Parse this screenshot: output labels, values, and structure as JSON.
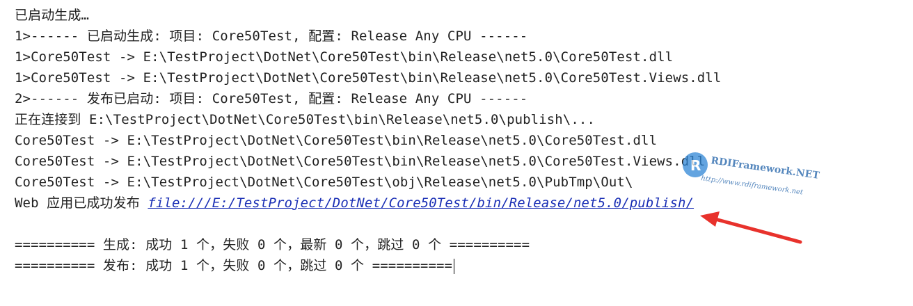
{
  "output": {
    "lines": [
      "已启动生成…",
      "1>------ 已启动生成: 项目: Core50Test, 配置: Release Any CPU ------",
      "1>Core50Test -> E:\\TestProject\\DotNet\\Core50Test\\bin\\Release\\net5.0\\Core50Test.dll",
      "1>Core50Test -> E:\\TestProject\\DotNet\\Core50Test\\bin\\Release\\net5.0\\Core50Test.Views.dll",
      "2>------ 发布已启动: 项目: Core50Test, 配置: Release Any CPU ------",
      "正在连接到 E:\\TestProject\\DotNet\\Core50Test\\bin\\Release\\net5.0\\publish\\...",
      "Core50Test -> E:\\TestProject\\DotNet\\Core50Test\\bin\\Release\\net5.0\\Core50Test.dll",
      "Core50Test -> E:\\TestProject\\DotNet\\Core50Test\\bin\\Release\\net5.0\\Core50Test.Views.dll",
      "Core50Test -> E:\\TestProject\\DotNet\\Core50Test\\obj\\Release\\net5.0\\PubTmp\\Out\\"
    ],
    "publish_prefix": "Web 应用已成功发布 ",
    "publish_link": "file:///E:/TestProject/DotNet/Core50Test/bin/Release/net5.0/publish/",
    "build_summary": "========== 生成: 成功 1 个，失败 0 个，最新 0 个，跳过 0 个 ==========",
    "publish_summary": "========== 发布: 成功 1 个，失败 0 个，跳过 0 个 =========="
  },
  "watermark": {
    "title": "RDIFramework.NET",
    "url": "http://www.rdiframework.net"
  },
  "colors": {
    "link": "#1a2fb5",
    "arrow": "#e8322c",
    "text": "#222222"
  }
}
